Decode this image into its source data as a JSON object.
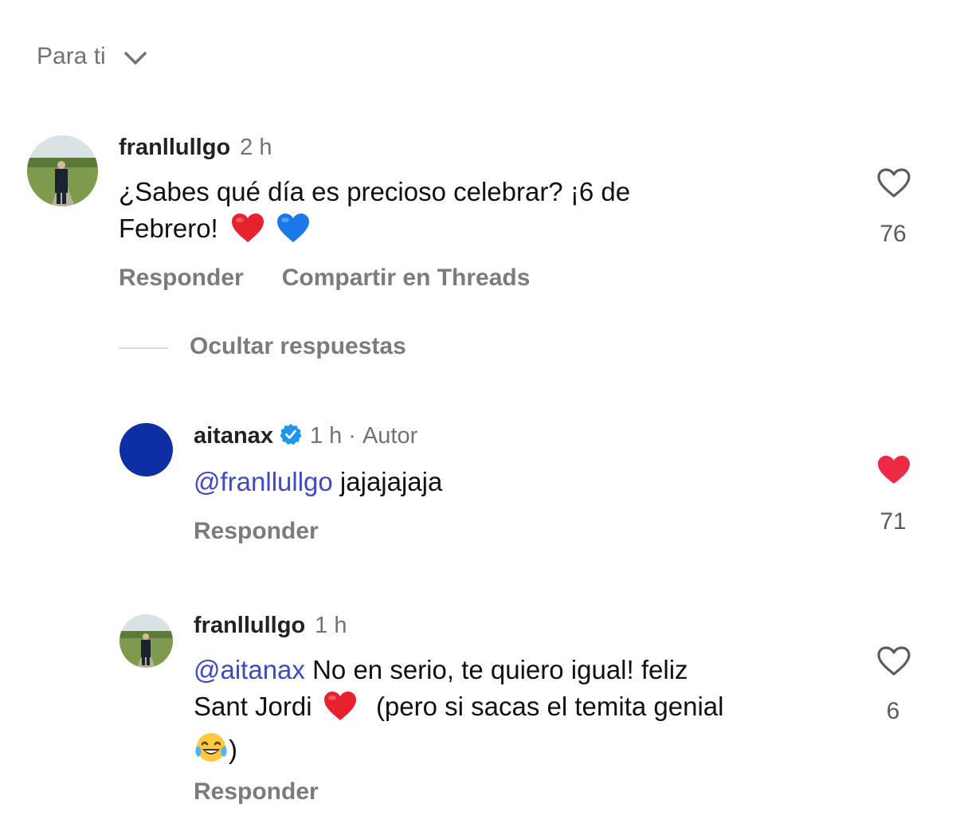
{
  "sort": {
    "label": "Para ti"
  },
  "colors": {
    "mention": "#3f4bc4",
    "liked_heart": "#ed2a46",
    "verified": "#1d96ef",
    "muted": "#737373"
  },
  "comment": {
    "username": "franllullgo",
    "time": "2 h",
    "text_part1": "¿Sabes qué día es precioso celebrar? ¡6 de",
    "text_part2": "Febrero!",
    "emojis": [
      "red-heart",
      "blue-heart"
    ],
    "likes": "76",
    "reply_label": "Responder",
    "share_label": "Compartir en Threads",
    "hide_replies_label": "Ocultar respuestas"
  },
  "replies": [
    {
      "username": "aitanax",
      "verified": true,
      "time": "1 h",
      "separator": "·",
      "badge": "Autor",
      "mention": "@franllullgo",
      "text": "jajajajaja",
      "likes": "71",
      "liked": true,
      "reply_label": "Responder"
    },
    {
      "username": "franllullgo",
      "time": "1 h",
      "mention": "@aitanax",
      "text_line1": "No en serio, te quiero igual! feliz",
      "text_line2a": "Sant Jordi",
      "text_line2b": "(pero si sacas el temita genial",
      "text_line3": ")",
      "emojis": [
        "red-heart",
        "tears-of-joy"
      ],
      "likes": "6",
      "liked": false,
      "reply_label": "Responder"
    }
  ]
}
